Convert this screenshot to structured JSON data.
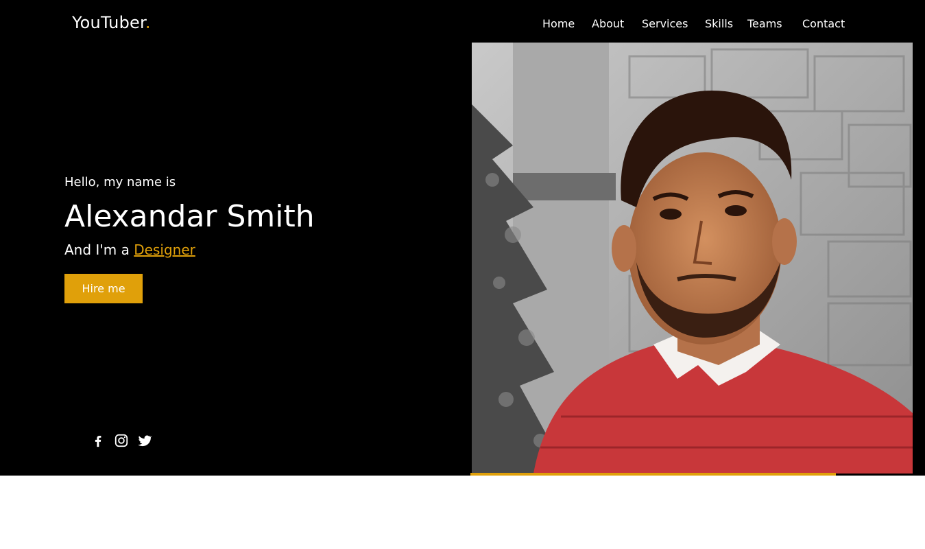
{
  "brand": {
    "name": "YouTuber",
    "dot": ".",
    "accent_color": "#e0a00a"
  },
  "nav": {
    "items": [
      {
        "label": "Home"
      },
      {
        "label": "About"
      },
      {
        "label": "Services"
      },
      {
        "label": "Skills"
      },
      {
        "label": "Teams"
      },
      {
        "label": "Contact"
      }
    ]
  },
  "hero": {
    "greeting": "Hello, my name is",
    "name": "Alexandar Smith",
    "role_prefix": "And I'm a ",
    "role": "Designer",
    "cta_label": "Hire me",
    "background_color": "#000000"
  },
  "socials": [
    {
      "icon": "facebook-icon"
    },
    {
      "icon": "instagram-icon"
    },
    {
      "icon": "twitter-icon"
    }
  ],
  "portrait": {
    "icon": "profile-photo"
  }
}
